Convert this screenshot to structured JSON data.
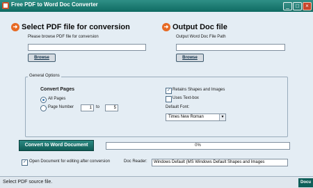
{
  "window": {
    "title": "Free PDF to Word Doc Converter",
    "minimize": "_",
    "maximize": "□",
    "close": "×"
  },
  "input": {
    "heading": "Select PDF file for conversion",
    "hint": "Please browse PDF file for conversion",
    "value": "",
    "browse_label": "Browse"
  },
  "output": {
    "heading": "Output Doc file",
    "hint": "Output Word Doc File Path",
    "value": "",
    "browse_label": "Browse"
  },
  "options": {
    "group_label": "General Options",
    "convert_pages_label": "Convert Pages",
    "all_pages_label": "All Pages",
    "page_number_label": "Page Number",
    "from_value": "1",
    "to_label": "to",
    "to_value": "5",
    "retains_label": "Retains Shapes and Images",
    "uses_textbox_label": "Uses Text-box",
    "default_font_label": "Default Font:",
    "default_font_value": "Times New Roman",
    "dropdown_arrow": "▼",
    "retains_checked": "✓"
  },
  "actions": {
    "convert_label": "Convert to Word Document",
    "progress_text": "0%"
  },
  "bottom": {
    "open_after_label": "Open Document for editing after conversion",
    "open_after_checked": "✓",
    "doc_reader_label": "Doc Reader:",
    "doc_reader_value": "Windows Default (MS Windows Default Shapes and Images"
  },
  "status": {
    "text": "Select PDF source file.",
    "tab_label": "Docu"
  }
}
